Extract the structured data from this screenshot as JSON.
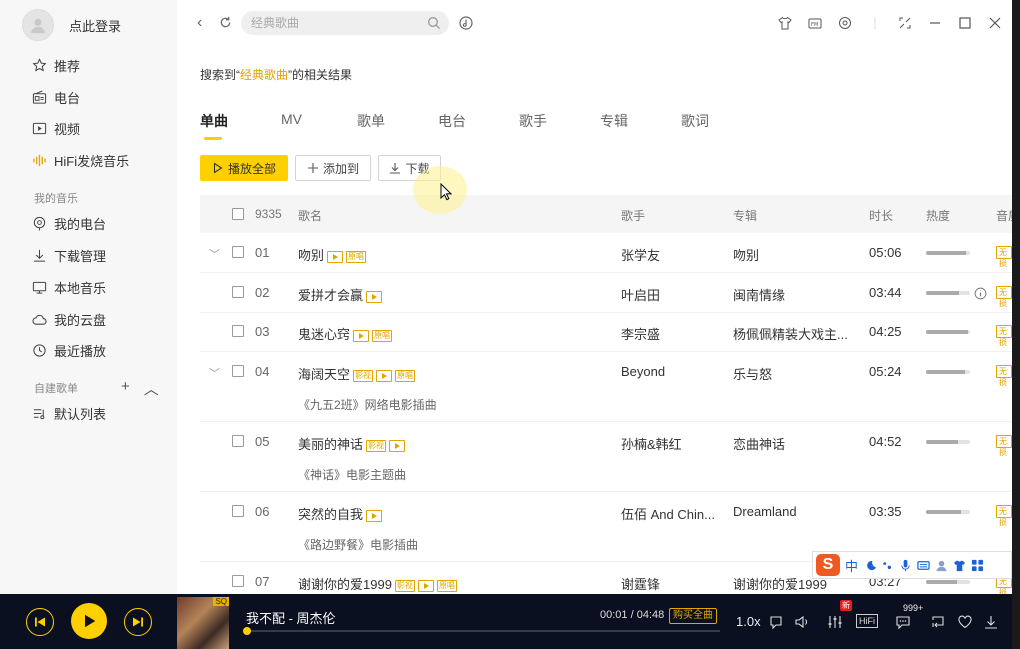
{
  "sidebar": {
    "login_text": "点此登录",
    "items": [
      {
        "label": "推荐",
        "icon": "star-icon"
      },
      {
        "label": "电台",
        "icon": "radio-icon"
      },
      {
        "label": "视频",
        "icon": "video-icon"
      },
      {
        "label": "HiFi发烧音乐",
        "icon": "soundwave-icon"
      }
    ],
    "my_music_title": "我的音乐",
    "my_music_items": [
      {
        "label": "我的电台",
        "icon": "my-radio-icon"
      },
      {
        "label": "下载管理",
        "icon": "download-icon"
      },
      {
        "label": "本地音乐",
        "icon": "monitor-icon"
      },
      {
        "label": "我的云盘",
        "icon": "cloud-icon"
      },
      {
        "label": "最近播放",
        "icon": "clock-icon"
      }
    ],
    "custom_title": "自建歌单",
    "custom_items": [
      {
        "label": "默认列表",
        "icon": "playlist-icon"
      }
    ]
  },
  "header": {
    "search_placeholder": "经典歌曲"
  },
  "result": {
    "prefix": "搜索到“",
    "keyword": "经典歌曲",
    "suffix": "”的相关结果"
  },
  "tabs": [
    "单曲",
    "MV",
    "歌单",
    "电台",
    "歌手",
    "专辑",
    "歌词"
  ],
  "actions": {
    "play_all": "播放全部",
    "add_to": "添加到",
    "download": "下载"
  },
  "table": {
    "count": "9335",
    "columns": {
      "name": "歌名",
      "artist": "歌手",
      "album": "专辑",
      "duration": "时长",
      "heat": "热度",
      "quality": "音质"
    },
    "rows": [
      {
        "num": "01",
        "name": "吻别",
        "tags": [
          "play",
          "原唱"
        ],
        "artist": "张学友",
        "album": "吻别",
        "duration": "05:06",
        "heat": 0.92,
        "quality": "无损",
        "expandable": true,
        "subtitle": ""
      },
      {
        "num": "02",
        "name": "爱拼才会赢",
        "tags": [
          "play"
        ],
        "artist": "叶启田",
        "album": "闽南情缘",
        "duration": "03:44",
        "heat": 0.75,
        "quality": "无损",
        "expandable": false,
        "subtitle": "",
        "info": true
      },
      {
        "num": "03",
        "name": "鬼迷心窍",
        "tags": [
          "play",
          "原唱"
        ],
        "artist": "李宗盛",
        "album": "杨佩佩精装大戏主...",
        "duration": "04:25",
        "heat": 0.95,
        "quality": "无损",
        "expandable": false,
        "subtitle": ""
      },
      {
        "num": "04",
        "name": "海阔天空",
        "tags": [
          "影视",
          "play",
          "原唱"
        ],
        "artist": "Beyond",
        "album": "乐与怒",
        "duration": "05:24",
        "heat": 0.88,
        "quality": "无损",
        "expandable": true,
        "subtitle": "《九五2班》网络电影插曲"
      },
      {
        "num": "05",
        "name": "美丽的神话",
        "tags": [
          "影视",
          "play"
        ],
        "artist": "孙楠&韩红",
        "album": "恋曲神话",
        "duration": "04:52",
        "heat": 0.72,
        "quality": "无损",
        "expandable": false,
        "subtitle": "《神话》电影主题曲"
      },
      {
        "num": "06",
        "name": "突然的自我",
        "tags": [
          "play"
        ],
        "artist": "伍佰 And Chin...",
        "album": "Dreamland",
        "duration": "03:35",
        "heat": 0.8,
        "quality": "无损",
        "expandable": false,
        "subtitle": "《路边野餐》电影插曲"
      },
      {
        "num": "07",
        "name": "谢谢你的爱1999",
        "tags": [
          "影视",
          "play",
          "原唱"
        ],
        "artist": "谢霆锋",
        "album": "谢谢你的爱1999",
        "duration": "03:27",
        "heat": 0.7,
        "quality": "无损",
        "expandable": false,
        "subtitle": ""
      }
    ]
  },
  "ime": {
    "mode": "中"
  },
  "player": {
    "song": "我不配 - 周杰伦",
    "time": "00:01 / 04:48",
    "buy_label": "购买全曲",
    "speed": "1.0x",
    "progress": 0.002,
    "hifi_label": "HiFi",
    "new_badge": "新",
    "comment_count": "999+",
    "cover_badge": "SQ",
    "accent": "#ffd000"
  }
}
